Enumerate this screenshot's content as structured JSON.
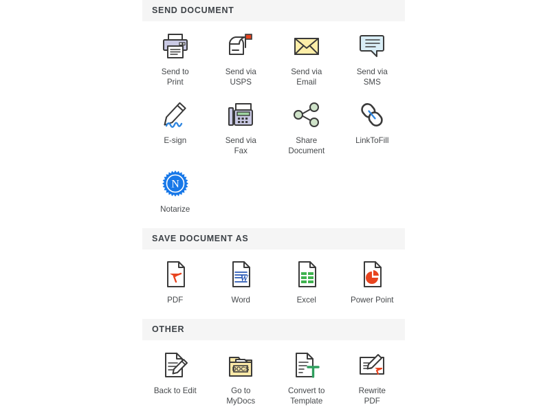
{
  "sections": [
    {
      "title": "SEND DOCUMENT",
      "name": "send-document",
      "tiles": [
        {
          "label": "Send to\nPrint",
          "icon": "printer-icon",
          "name": "send-to-print"
        },
        {
          "label": "Send via\nUSPS",
          "icon": "mailbox-icon",
          "name": "send-via-usps"
        },
        {
          "label": "Send via\nEmail",
          "icon": "envelope-icon",
          "name": "send-via-email"
        },
        {
          "label": "Send via\nSMS",
          "icon": "chat-bubble-icon",
          "name": "send-via-sms"
        },
        {
          "label": "E-sign",
          "icon": "pencil-signature-icon",
          "name": "e-sign"
        },
        {
          "label": "Send via\nFax",
          "icon": "fax-machine-icon",
          "name": "send-via-fax"
        },
        {
          "label": "Share\nDocument",
          "icon": "share-nodes-icon",
          "name": "share-document"
        },
        {
          "label": "LinkToFill",
          "icon": "chain-link-icon",
          "name": "link-to-fill"
        },
        {
          "label": "Notarize",
          "icon": "notary-seal-icon",
          "name": "notarize"
        }
      ]
    },
    {
      "title": "SAVE DOCUMENT AS",
      "name": "save-document-as",
      "tiles": [
        {
          "label": "PDF",
          "icon": "pdf-file-icon",
          "name": "save-as-pdf"
        },
        {
          "label": "Word",
          "icon": "word-file-icon",
          "name": "save-as-word"
        },
        {
          "label": "Excel",
          "icon": "excel-file-icon",
          "name": "save-as-excel"
        },
        {
          "label": "Power Point",
          "icon": "powerpoint-file-icon",
          "name": "save-as-powerpoint"
        }
      ]
    },
    {
      "title": "OTHER",
      "name": "other",
      "tiles": [
        {
          "label": "Back to Edit",
          "icon": "document-pencil-icon",
          "name": "back-to-edit"
        },
        {
          "label": "Go to\nMyDocs",
          "icon": "docs-folder-icon",
          "name": "go-to-mydocs"
        },
        {
          "label": "Convert to\nTemplate",
          "icon": "template-t-icon",
          "name": "convert-to-template"
        },
        {
          "label": "Rewrite\nPDF",
          "icon": "rewrite-pdf-icon",
          "name": "rewrite-pdf"
        }
      ]
    }
  ],
  "colors": {
    "section_header_bg": "#f5f5f5",
    "section_header_text": "#3d4247",
    "label_text": "#45484b",
    "outline": "#3a3a3a",
    "lavender": "#c9c9e4",
    "envelope_yellow": "#fdeea8",
    "sms_blue": "#d9eef7",
    "signature_blue": "#2f86e0",
    "share_green": "#cfe3c9",
    "notary_blue": "#1878e8",
    "folder_yellow": "#fbe9a8",
    "pdf_red": "#e8441f",
    "word_blue": "#2b59b5",
    "excel_green": "#3fb34f",
    "ppt_orange": "#e8441f",
    "template_green": "#2f9e5e",
    "fax_screen_green": "#9fd3a0"
  }
}
